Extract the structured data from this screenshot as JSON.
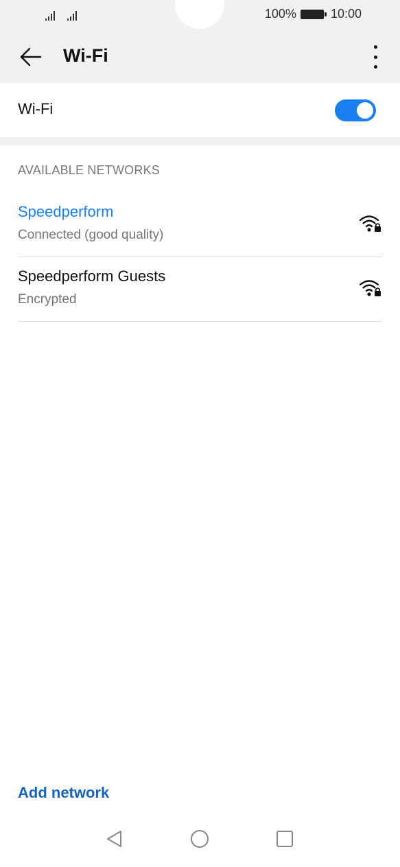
{
  "status_bar": {
    "battery_percent": "100%",
    "time": "10:00"
  },
  "toolbar": {
    "title": "Wi-Fi"
  },
  "wifi_toggle": {
    "label": "Wi-Fi",
    "enabled": true,
    "accent_color": "#1a7ff0"
  },
  "networks_section": {
    "header": "AVAILABLE NETWORKS",
    "items": [
      {
        "name": "Speedperform",
        "status": "Connected (good quality)",
        "icon": "wifi-locked-icon"
      },
      {
        "name": "Speedperform Guests",
        "status": "Encrypted",
        "icon": "wifi-locked-icon"
      }
    ]
  },
  "footer": {
    "add_network_label": "Add network"
  },
  "nav_bar": {
    "icons": [
      "back-triangle-icon",
      "home-circle-icon",
      "recents-square-icon"
    ]
  }
}
